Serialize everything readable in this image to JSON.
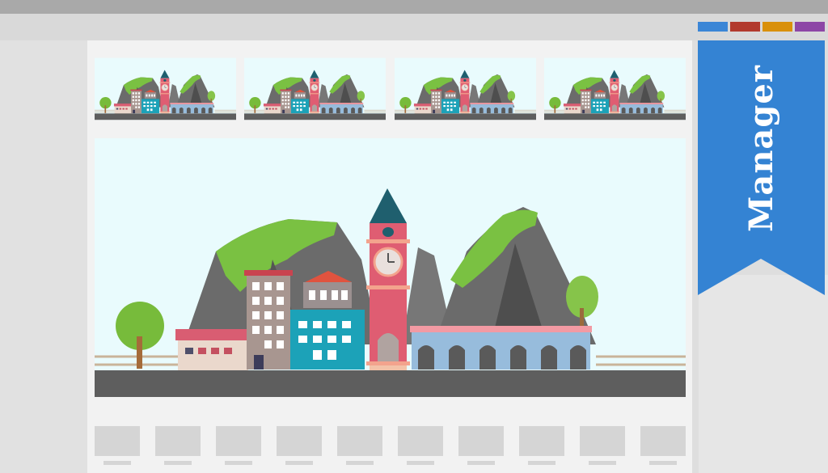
{
  "window": {
    "panel_title": "Manager"
  },
  "colors": {
    "swatches": [
      "#3b86d6",
      "#b23a2e",
      "#d9900a",
      "#8d46a6"
    ],
    "banner": "#3483d3",
    "sky": "#e9fbfd",
    "road": "#5e5e5e"
  },
  "thumbnails": [
    {
      "name": "scene-1"
    },
    {
      "name": "scene-2"
    },
    {
      "name": "scene-3"
    },
    {
      "name": "scene-4"
    }
  ],
  "slots_count": 10
}
